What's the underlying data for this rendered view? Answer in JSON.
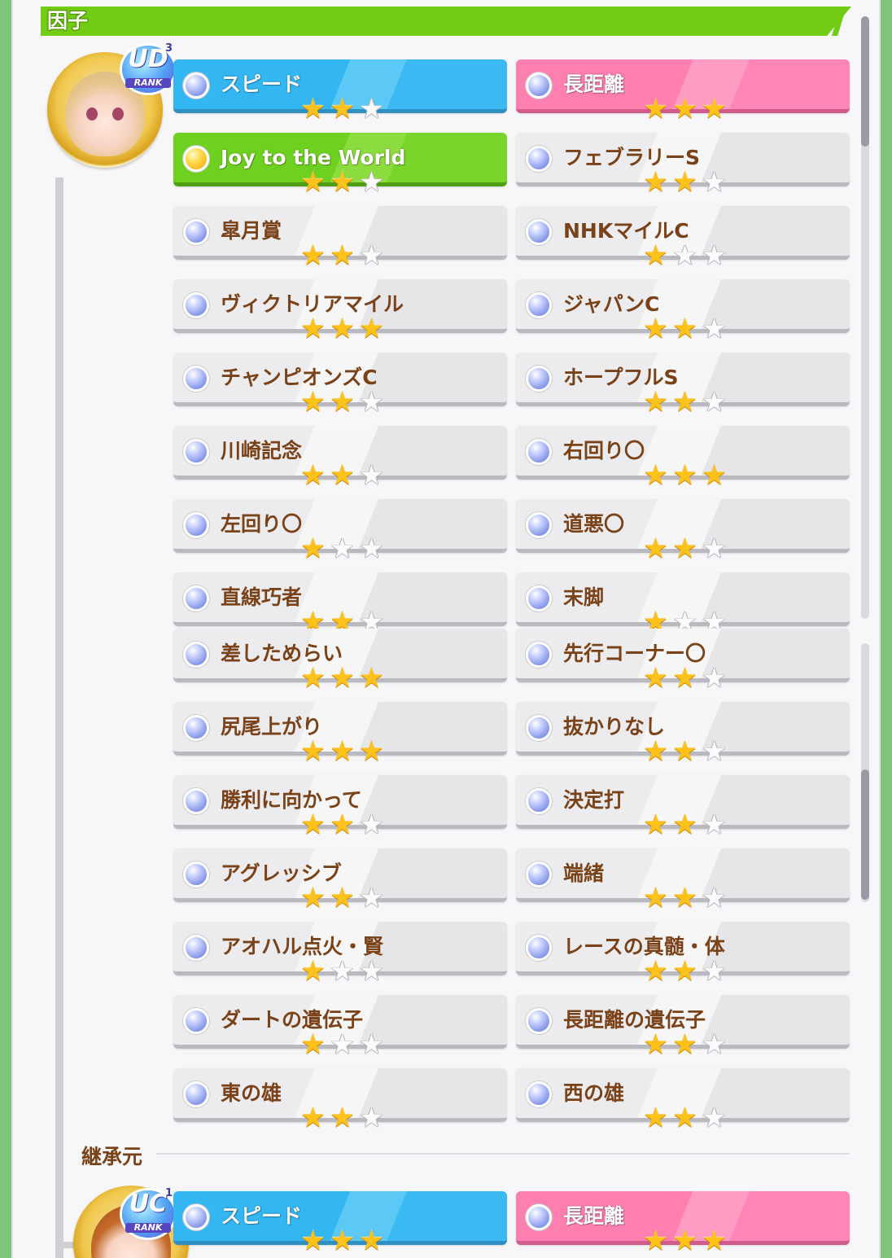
{
  "header": {
    "title": "因子"
  },
  "avatars": [
    {
      "rank": "UD",
      "rank_sup": "3",
      "rank_label": "RANK"
    },
    {
      "rank": "UC",
      "rank_sup": "1",
      "rank_label": "RANK"
    }
  ],
  "section_inherit": {
    "title": "継承元"
  },
  "factors": [
    {
      "name": "スピード",
      "stars": 2,
      "style": "blue"
    },
    {
      "name": "長距離",
      "stars": 3,
      "style": "pink"
    },
    {
      "name": "Joy to the World",
      "stars": 2,
      "style": "green"
    },
    {
      "name": "フェブラリーS",
      "stars": 2,
      "style": "white"
    },
    {
      "name": "皐月賞",
      "stars": 2,
      "style": "white"
    },
    {
      "name": "NHKマイルC",
      "stars": 1,
      "style": "white"
    },
    {
      "name": "ヴィクトリアマイル",
      "stars": 3,
      "style": "white"
    },
    {
      "name": "ジャパンC",
      "stars": 2,
      "style": "white"
    },
    {
      "name": "チャンピオンズC",
      "stars": 2,
      "style": "white"
    },
    {
      "name": "ホープフルS",
      "stars": 2,
      "style": "white"
    },
    {
      "name": "川崎記念",
      "stars": 2,
      "style": "white"
    },
    {
      "name": "右回り〇",
      "stars": 3,
      "style": "white"
    },
    {
      "name": "左回り〇",
      "stars": 1,
      "style": "white"
    },
    {
      "name": "道悪〇",
      "stars": 2,
      "style": "white"
    },
    {
      "name": "直線巧者",
      "stars": 2,
      "style": "white"
    },
    {
      "name": "末脚",
      "stars": 1,
      "style": "white"
    },
    {
      "name": "差しためらい",
      "stars": 3,
      "style": "white"
    },
    {
      "name": "先行コーナー〇",
      "stars": 2,
      "style": "white"
    },
    {
      "name": "尻尾上がり",
      "stars": 3,
      "style": "white"
    },
    {
      "name": "抜かりなし",
      "stars": 2,
      "style": "white"
    },
    {
      "name": "勝利に向かって",
      "stars": 2,
      "style": "white"
    },
    {
      "name": "決定打",
      "stars": 2,
      "style": "white"
    },
    {
      "name": "アグレッシブ",
      "stars": 2,
      "style": "white"
    },
    {
      "name": "端緒",
      "stars": 2,
      "style": "white"
    },
    {
      "name": "アオハル点火・賢",
      "stars": 1,
      "style": "white"
    },
    {
      "name": "レースの真髄・体",
      "stars": 2,
      "style": "white"
    },
    {
      "name": "ダートの遺伝子",
      "stars": 1,
      "style": "white"
    },
    {
      "name": "長距離の遺伝子",
      "stars": 2,
      "style": "white"
    },
    {
      "name": "東の雄",
      "stars": 2,
      "style": "white"
    },
    {
      "name": "西の雄",
      "stars": 2,
      "style": "white"
    }
  ],
  "factors_parent": [
    {
      "name": "スピード",
      "stars": 3,
      "style": "blue"
    },
    {
      "name": "長距離",
      "stars": 3,
      "style": "pink"
    }
  ]
}
